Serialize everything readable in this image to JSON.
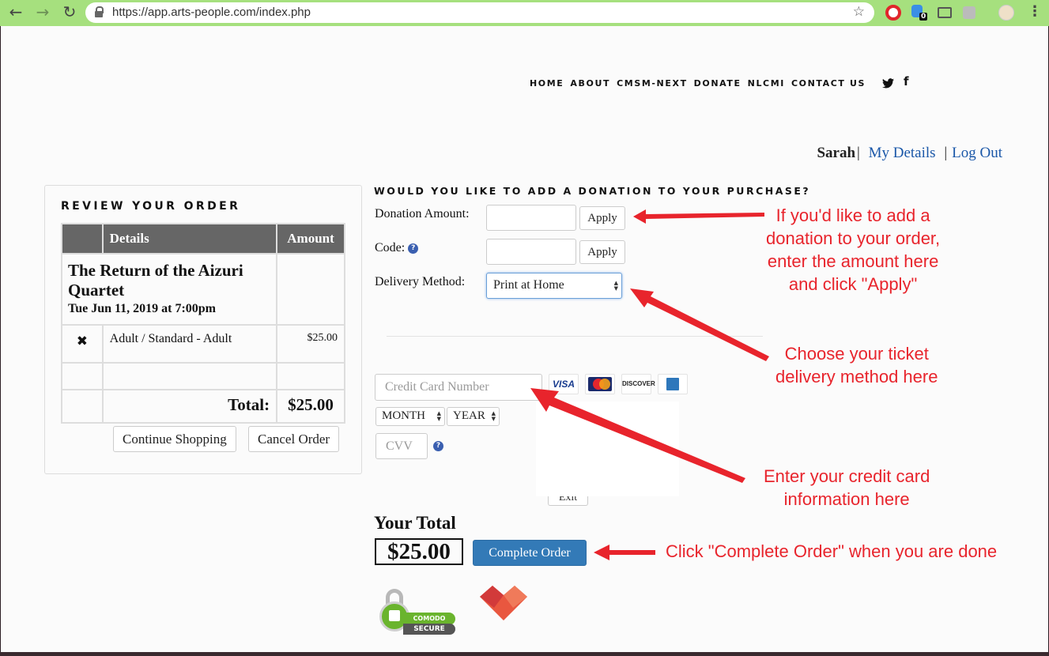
{
  "browser": {
    "url": "https://app.arts-people.com/index.php",
    "badge_count": "0"
  },
  "nav": {
    "items": [
      "HOME",
      "ABOUT",
      "CMSM-NEXT",
      "DONATE",
      "NLCMI",
      "CONTACT US"
    ],
    "twitter_icon": "twitter-icon",
    "facebook_icon": "facebook-icon"
  },
  "user": {
    "name": "Sarah",
    "separator": "|",
    "my_details": "My Details",
    "log_out": "Log Out"
  },
  "review": {
    "title": "REVIEW YOUR ORDER",
    "columns": [
      "Details",
      "Amount"
    ],
    "event_title": "The Return of the Aizuri Quartet",
    "event_date": "Tue Jun 11, 2019 at 7:00pm",
    "remove_icon": "✖",
    "line_item": "Adult / Standard - Adult",
    "line_price": "$25.00",
    "total_label": "Total:",
    "total_value": "$25.00",
    "continue_label": "Continue Shopping",
    "cancel_label": "Cancel Order"
  },
  "donation": {
    "heading": "WOULD YOU LIKE TO ADD A DONATION TO YOUR PURCHASE?",
    "amount_label": "Donation Amount:",
    "amount_value": "",
    "apply_label": "Apply",
    "code_label": "Code:",
    "code_value": "",
    "delivery_label": "Delivery Method:",
    "delivery_value": "Print at Home",
    "help_icon": "?"
  },
  "payment": {
    "card_placeholder": "Credit Card Number",
    "month_value": "MONTH",
    "year_value": "YEAR",
    "cvv_placeholder": "CVV",
    "cards": [
      "VISA",
      "MasterCard",
      "DISCOVER",
      "AMERICAN EXPRESS"
    ],
    "exit_label": "Exit"
  },
  "summary": {
    "your_total_label": "Your Total",
    "total_value": "$25.00",
    "complete_label": "Complete Order"
  },
  "badges": {
    "comodo_top": "COMODO",
    "comodo_bottom": "SECURE"
  },
  "annotations": {
    "donation": [
      "If you'd like to add a",
      "donation to your order,",
      "enter the amount here",
      "and click \"Apply\""
    ],
    "delivery": [
      "Choose your ticket",
      "delivery method here"
    ],
    "card": [
      "Enter your credit card",
      "information here"
    ],
    "complete": "Click \"Complete Order\" when you are done",
    "color": "#e8242c"
  }
}
